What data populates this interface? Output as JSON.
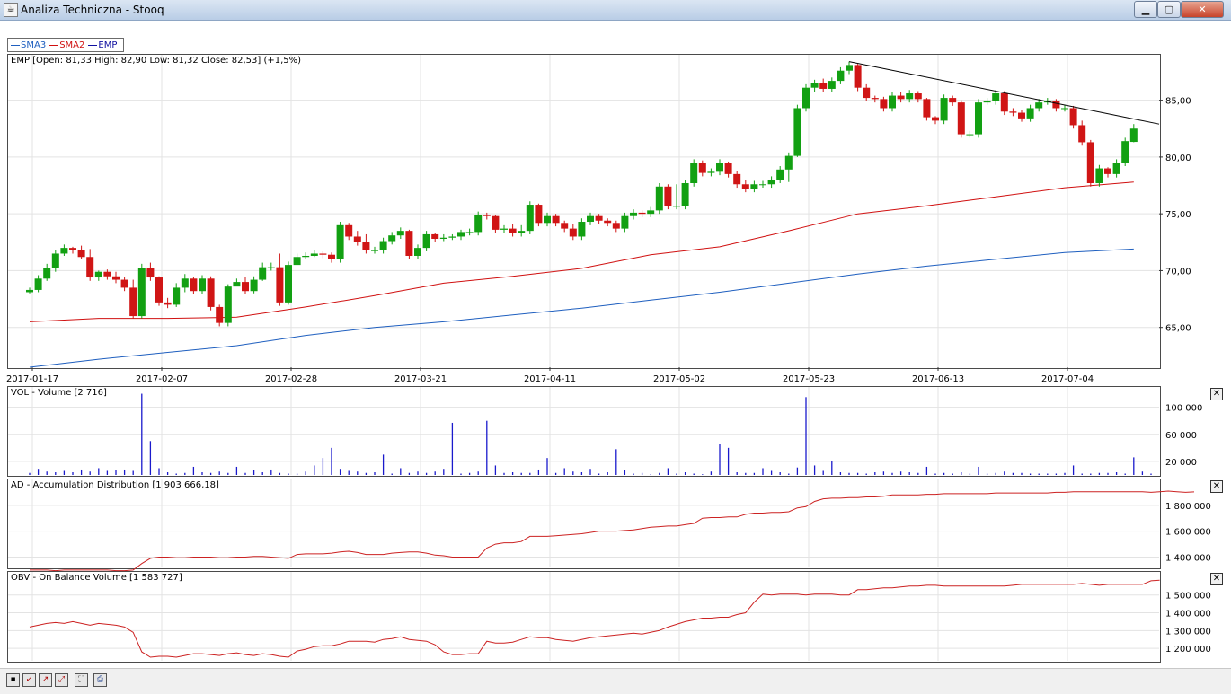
{
  "window": {
    "title": "Analiza Techniczna - Stooq",
    "app_icon": "java-icon",
    "min_icon": "minimize-icon",
    "max_icon": "maximize-icon",
    "close_icon": "close-icon"
  },
  "legend": [
    {
      "label": "SMA3",
      "color": "#1f5fbf"
    },
    {
      "label": "SMA2",
      "color": "#d01010"
    },
    {
      "label": "EMP",
      "color": "#1010a0"
    }
  ],
  "colors": {
    "up": "#12a012",
    "down": "#d01515",
    "grid": "#e3e3e3",
    "sma2": "#d01010",
    "sma3": "#1f5fbf",
    "volume": "#1a1acc",
    "ad": "#cc2222",
    "obv": "#cc2222",
    "trendline": "#000000"
  },
  "panels": {
    "price_title": "EMP [Open: 81,33  High: 82,90  Low: 81,32  Close: 82,53] (+1,5%)",
    "volume_title": "VOL - Volume [2 716]",
    "ad_title": "AD - Accumulation Distribution [1 903 666,18]",
    "obv_title": "OBV - On Balance Volume [1 583 727]"
  },
  "toolbar": {
    "icons": [
      "save-icon",
      "zoom-in-icon",
      "zoom-out-icon",
      "zoom-fit-icon",
      "fullscreen-icon",
      "print-icon"
    ]
  },
  "chart_data": [
    {
      "type": "candlestick",
      "title": "EMP [Open: 81,33  High: 82,90  Low: 81,32  Close: 82,53] (+1,5%)",
      "x_tick_labels": [
        "2017-01-17",
        "2017-02-07",
        "2017-02-28",
        "2017-03-21",
        "2017-04-11",
        "2017-05-02",
        "2017-05-23",
        "2017-06-13",
        "2017-07-04"
      ],
      "y_tick_labels": [
        "85,00",
        "80,00",
        "75,00",
        "70,00",
        "65,00"
      ],
      "y_ticks": [
        85,
        80,
        75,
        70,
        65
      ],
      "ylim": [
        61.5,
        89
      ],
      "grid": true,
      "legend_position": "top-left",
      "closes": [
        68.3,
        69.3,
        70.2,
        71.5,
        72.0,
        71.8,
        71.2,
        69.4,
        69.9,
        69.5,
        69.2,
        68.5,
        66.0,
        70.2,
        69.4,
        67.2,
        67.0,
        68.5,
        69.3,
        68.2,
        69.3,
        66.8,
        65.4,
        68.6,
        69.0,
        68.2,
        69.2,
        70.3,
        70.3,
        67.2,
        70.5,
        71.2,
        71.3,
        71.5,
        71.4,
        71.0,
        74.0,
        73.0,
        72.5,
        71.8,
        71.8,
        72.6,
        73.1,
        73.5,
        71.3,
        72.0,
        73.2,
        72.8,
        72.9,
        73.0,
        73.4,
        73.4,
        74.9,
        74.8,
        73.6,
        73.7,
        73.3,
        73.5,
        75.8,
        74.2,
        74.8,
        74.2,
        73.7,
        73.0,
        74.3,
        74.8,
        74.4,
        74.2,
        73.7,
        74.8,
        75.1,
        75.0,
        75.3,
        77.4,
        75.7,
        75.7,
        77.7,
        79.5,
        78.6,
        78.7,
        79.5,
        78.5,
        77.6,
        77.2,
        77.6,
        77.6,
        78.0,
        78.9,
        80.1,
        84.3,
        86.1,
        86.5,
        86.0,
        86.7,
        87.6,
        88.1,
        86.1,
        85.2,
        85.1,
        84.3,
        85.4,
        85.1,
        85.6,
        85.1,
        83.5,
        83.2,
        85.2,
        84.8,
        82.0,
        82.0,
        84.8,
        84.9,
        85.6,
        84.0,
        83.9,
        83.4,
        84.3,
        84.8,
        84.9,
        84.3,
        84.3,
        82.8,
        81.3,
        77.7,
        79.0,
        78.5,
        79.5,
        81.4,
        82.5
      ],
      "highs": [
        68.5,
        69.6,
        70.6,
        71.8,
        72.3,
        72.1,
        72.2,
        71.9,
        70.0,
        70.1,
        69.9,
        69.4,
        69.2,
        70.6,
        70.7,
        69.5,
        67.6,
        68.9,
        69.7,
        69.4,
        69.6,
        69.5,
        67.0,
        68.8,
        69.3,
        69.4,
        69.5,
        70.7,
        70.7,
        71.5,
        70.8,
        71.5,
        71.6,
        71.8,
        71.7,
        71.6,
        74.3,
        74.2,
        73.5,
        73.2,
        72.1,
        72.9,
        73.4,
        73.8,
        73.6,
        72.3,
        73.5,
        73.3,
        73.2,
        73.2,
        73.6,
        73.7,
        75.2,
        75.1,
        74.9,
        74.0,
        74.1,
        74.0,
        76.1,
        75.9,
        75.1,
        75.0,
        74.4,
        74.1,
        74.6,
        75.1,
        75.0,
        74.6,
        74.4,
        75.1,
        75.4,
        75.3,
        75.6,
        77.7,
        77.6,
        77.6,
        78.0,
        79.8,
        79.7,
        79.0,
        79.8,
        79.6,
        78.8,
        78.0,
        77.9,
        77.9,
        78.3,
        79.2,
        80.4,
        84.6,
        86.4,
        86.8,
        86.9,
        87.0,
        87.9,
        88.4,
        88.2,
        86.4,
        85.4,
        85.3,
        85.7,
        85.7,
        85.9,
        85.8,
        85.2,
        83.6,
        85.5,
        85.4,
        85.0,
        82.3,
        85.1,
        85.2,
        85.9,
        85.8,
        84.3,
        84.1,
        84.6,
        85.1,
        85.2,
        85.1,
        84.6,
        84.5,
        83.2,
        81.5,
        79.3,
        79.1,
        79.8,
        81.7,
        82.9
      ],
      "lows": [
        68.0,
        68.1,
        69.1,
        69.9,
        71.3,
        71.5,
        71.0,
        69.1,
        69.1,
        69.2,
        68.9,
        68.2,
        65.8,
        65.8,
        69.1,
        66.9,
        66.7,
        66.8,
        68.1,
        67.9,
        67.9,
        66.5,
        65.1,
        65.1,
        68.7,
        67.9,
        68.0,
        69.1,
        70.0,
        66.9,
        67.0,
        70.9,
        71.0,
        71.2,
        71.1,
        70.7,
        70.7,
        72.7,
        72.2,
        71.5,
        71.5,
        71.5,
        72.3,
        72.8,
        71.0,
        71.0,
        71.7,
        72.5,
        72.6,
        72.7,
        72.7,
        73.1,
        73.1,
        74.5,
        73.3,
        73.3,
        73.0,
        73.0,
        73.2,
        73.9,
        73.9,
        73.9,
        73.4,
        72.7,
        72.7,
        74.0,
        74.1,
        73.9,
        73.4,
        73.4,
        74.5,
        74.7,
        74.7,
        75.0,
        75.4,
        75.4,
        75.4,
        77.4,
        78.3,
        78.3,
        78.4,
        78.2,
        77.3,
        76.9,
        76.9,
        77.3,
        77.3,
        77.7,
        77.8,
        80.0,
        84.0,
        85.7,
        85.7,
        85.7,
        86.4,
        87.3,
        85.8,
        84.9,
        84.8,
        84.0,
        84.0,
        84.8,
        84.8,
        84.8,
        83.2,
        82.9,
        82.9,
        84.5,
        81.7,
        81.7,
        81.7,
        84.6,
        84.6,
        83.7,
        83.6,
        83.1,
        83.1,
        84.0,
        84.6,
        84.0,
        84.0,
        82.5,
        81.0,
        77.4,
        77.4,
        78.2,
        78.2,
        79.2,
        81.3
      ],
      "opens": [
        68.1,
        68.3,
        69.3,
        70.2,
        71.5,
        72.0,
        71.8,
        71.2,
        69.4,
        69.9,
        69.5,
        69.2,
        68.5,
        66.0,
        70.2,
        69.4,
        67.2,
        67.0,
        68.5,
        69.3,
        68.2,
        69.3,
        66.8,
        65.4,
        68.6,
        69.0,
        68.2,
        69.2,
        70.3,
        70.3,
        67.2,
        70.5,
        71.2,
        71.3,
        71.5,
        71.4,
        71.0,
        74.0,
        73.0,
        72.5,
        71.8,
        71.8,
        72.6,
        73.1,
        73.5,
        71.3,
        72.0,
        73.2,
        72.8,
        72.9,
        73.0,
        73.4,
        73.4,
        74.9,
        74.8,
        73.6,
        73.7,
        73.3,
        73.5,
        75.8,
        74.2,
        74.8,
        74.2,
        73.7,
        73.0,
        74.3,
        74.8,
        74.4,
        74.2,
        73.7,
        74.8,
        75.1,
        75.0,
        75.3,
        77.4,
        75.7,
        75.7,
        77.7,
        79.5,
        78.6,
        78.7,
        79.5,
        78.5,
        77.6,
        77.2,
        77.6,
        77.6,
        78.0,
        78.9,
        80.1,
        84.3,
        86.1,
        86.5,
        86.0,
        86.7,
        87.6,
        88.1,
        86.1,
        85.2,
        85.1,
        84.3,
        85.4,
        85.1,
        85.6,
        85.1,
        83.5,
        83.2,
        85.2,
        84.8,
        82.0,
        82.0,
        84.8,
        84.9,
        85.6,
        84.0,
        83.9,
        83.4,
        84.3,
        84.8,
        84.9,
        84.3,
        84.3,
        82.8,
        81.3,
        77.7,
        79.0,
        78.5,
        79.5,
        81.33
      ],
      "series": [
        {
          "name": "SMA2",
          "y": [
            65.5,
            65.8,
            65.8,
            65.9,
            66.8,
            67.8,
            68.9,
            69.5,
            70.2,
            71.4,
            72.1,
            73.5,
            75.0,
            75.7,
            76.5,
            77.3,
            77.8
          ]
        },
        {
          "name": "SMA3",
          "y": [
            61.5,
            62.2,
            62.8,
            63.4,
            64.3,
            65.0,
            65.5,
            66.1,
            66.7,
            67.4,
            68.1,
            68.9,
            69.7,
            70.4,
            71.0,
            71.6,
            71.9
          ]
        }
      ]
    },
    {
      "type": "bar",
      "title": "VOL - Volume [2 716]",
      "y_tick_labels": [
        "100 000",
        "60 000",
        "20 000"
      ],
      "y_ticks": [
        100000,
        60000,
        20000
      ],
      "ylim": [
        0,
        130000
      ],
      "values": [
        3000,
        9000,
        5000,
        4000,
        6000,
        4000,
        8000,
        5000,
        10000,
        6000,
        7000,
        8000,
        6000,
        120000,
        50000,
        10000,
        4000,
        2000,
        3000,
        12000,
        4000,
        3000,
        5000,
        3000,
        12000,
        3000,
        7000,
        4000,
        8000,
        3000,
        2000,
        2000,
        5000,
        14000,
        25000,
        40000,
        9000,
        6000,
        5000,
        3000,
        4000,
        30000,
        2000,
        10000,
        3000,
        5000,
        3000,
        5000,
        9000,
        77000,
        2000,
        3000,
        5000,
        80000,
        14000,
        3000,
        4000,
        3000,
        3000,
        8000,
        25000,
        3000,
        10000,
        5000,
        4000,
        9000,
        2000,
        4000,
        38000,
        7000,
        2000,
        3000,
        1000,
        3000,
        10000,
        2000,
        4000,
        2000,
        1000,
        5000,
        46000,
        40000,
        4000,
        3000,
        3000,
        10000,
        6000,
        4000,
        2000,
        11000,
        115000,
        14000,
        6000,
        20000,
        4000,
        3000,
        3000,
        2000,
        4000,
        5000,
        3000,
        5000,
        4000,
        3000,
        12000,
        2000,
        3000,
        2000,
        4000,
        2000,
        12000,
        2000,
        3000,
        5000,
        3000,
        3000,
        2000,
        2000,
        2000,
        2000,
        3000,
        14000,
        2000,
        2000,
        3000,
        3000,
        4000,
        2000,
        26000,
        5000,
        2000
      ]
    },
    {
      "type": "line",
      "title": "AD - Accumulation Distribution [1 903 666,18]",
      "y_tick_labels": [
        "1 800 000",
        "1 600 000",
        "1 400 000"
      ],
      "y_ticks": [
        1800000,
        1600000,
        1400000
      ],
      "ylim": [
        1320000,
        2000000
      ],
      "series": [
        {
          "name": "AD",
          "values": [
            1300000,
            1300000,
            1300000,
            1295000,
            1300000,
            1300000,
            1300000,
            1300000,
            1300000,
            1300000,
            1295000,
            1295000,
            1300000,
            1350000,
            1390000,
            1400000,
            1400000,
            1395000,
            1395000,
            1400000,
            1400000,
            1400000,
            1395000,
            1395000,
            1400000,
            1400000,
            1405000,
            1405000,
            1400000,
            1395000,
            1390000,
            1420000,
            1425000,
            1425000,
            1425000,
            1430000,
            1440000,
            1445000,
            1435000,
            1420000,
            1420000,
            1420000,
            1430000,
            1435000,
            1440000,
            1440000,
            1430000,
            1415000,
            1410000,
            1400000,
            1400000,
            1400000,
            1400000,
            1470000,
            1500000,
            1510000,
            1510000,
            1520000,
            1560000,
            1560000,
            1560000,
            1565000,
            1570000,
            1575000,
            1580000,
            1590000,
            1600000,
            1600000,
            1600000,
            1605000,
            1610000,
            1620000,
            1630000,
            1635000,
            1640000,
            1640000,
            1650000,
            1660000,
            1700000,
            1705000,
            1705000,
            1710000,
            1710000,
            1730000,
            1740000,
            1740000,
            1745000,
            1745000,
            1750000,
            1780000,
            1790000,
            1830000,
            1850000,
            1855000,
            1855000,
            1860000,
            1860000,
            1865000,
            1865000,
            1870000,
            1880000,
            1880000,
            1880000,
            1880000,
            1885000,
            1885000,
            1890000,
            1890000,
            1890000,
            1890000,
            1890000,
            1890000,
            1895000,
            1895000,
            1895000,
            1895000,
            1895000,
            1895000,
            1895000,
            1900000,
            1900000,
            1905000,
            1905000,
            1905000,
            1905000,
            1905000,
            1905000,
            1905000,
            1905000,
            1905000,
            1900000,
            1905000,
            1910000,
            1905000,
            1900000,
            1903666
          ]
        }
      ]
    },
    {
      "type": "line",
      "title": "OBV - On Balance Volume [1 583 727]",
      "y_tick_labels": [
        "1 500 000",
        "1 400 000",
        "1 300 000",
        "1 200 000"
      ],
      "y_ticks": [
        1500000,
        1400000,
        1300000,
        1200000
      ],
      "ylim": [
        1130000,
        1630000
      ],
      "series": [
        {
          "name": "OBV",
          "values": [
            1320000,
            1330000,
            1340000,
            1345000,
            1340000,
            1350000,
            1340000,
            1330000,
            1340000,
            1335000,
            1330000,
            1320000,
            1290000,
            1180000,
            1150000,
            1155000,
            1155000,
            1150000,
            1160000,
            1170000,
            1170000,
            1165000,
            1160000,
            1170000,
            1175000,
            1165000,
            1160000,
            1170000,
            1165000,
            1155000,
            1150000,
            1185000,
            1195000,
            1210000,
            1215000,
            1215000,
            1225000,
            1240000,
            1240000,
            1240000,
            1235000,
            1250000,
            1255000,
            1265000,
            1250000,
            1245000,
            1240000,
            1220000,
            1180000,
            1165000,
            1165000,
            1170000,
            1170000,
            1240000,
            1230000,
            1230000,
            1235000,
            1250000,
            1265000,
            1260000,
            1260000,
            1250000,
            1245000,
            1240000,
            1250000,
            1260000,
            1265000,
            1270000,
            1275000,
            1280000,
            1285000,
            1280000,
            1290000,
            1300000,
            1320000,
            1335000,
            1350000,
            1360000,
            1370000,
            1370000,
            1375000,
            1375000,
            1390000,
            1400000,
            1460000,
            1505000,
            1500000,
            1505000,
            1505000,
            1505000,
            1500000,
            1505000,
            1505000,
            1505000,
            1500000,
            1500000,
            1530000,
            1530000,
            1535000,
            1540000,
            1540000,
            1545000,
            1550000,
            1550000,
            1555000,
            1555000,
            1550000,
            1550000,
            1550000,
            1550000,
            1550000,
            1550000,
            1550000,
            1550000,
            1555000,
            1560000,
            1560000,
            1560000,
            1560000,
            1560000,
            1560000,
            1560000,
            1565000,
            1560000,
            1555000,
            1560000,
            1560000,
            1560000,
            1560000,
            1560000,
            1580000,
            1583727
          ]
        }
      ]
    }
  ]
}
